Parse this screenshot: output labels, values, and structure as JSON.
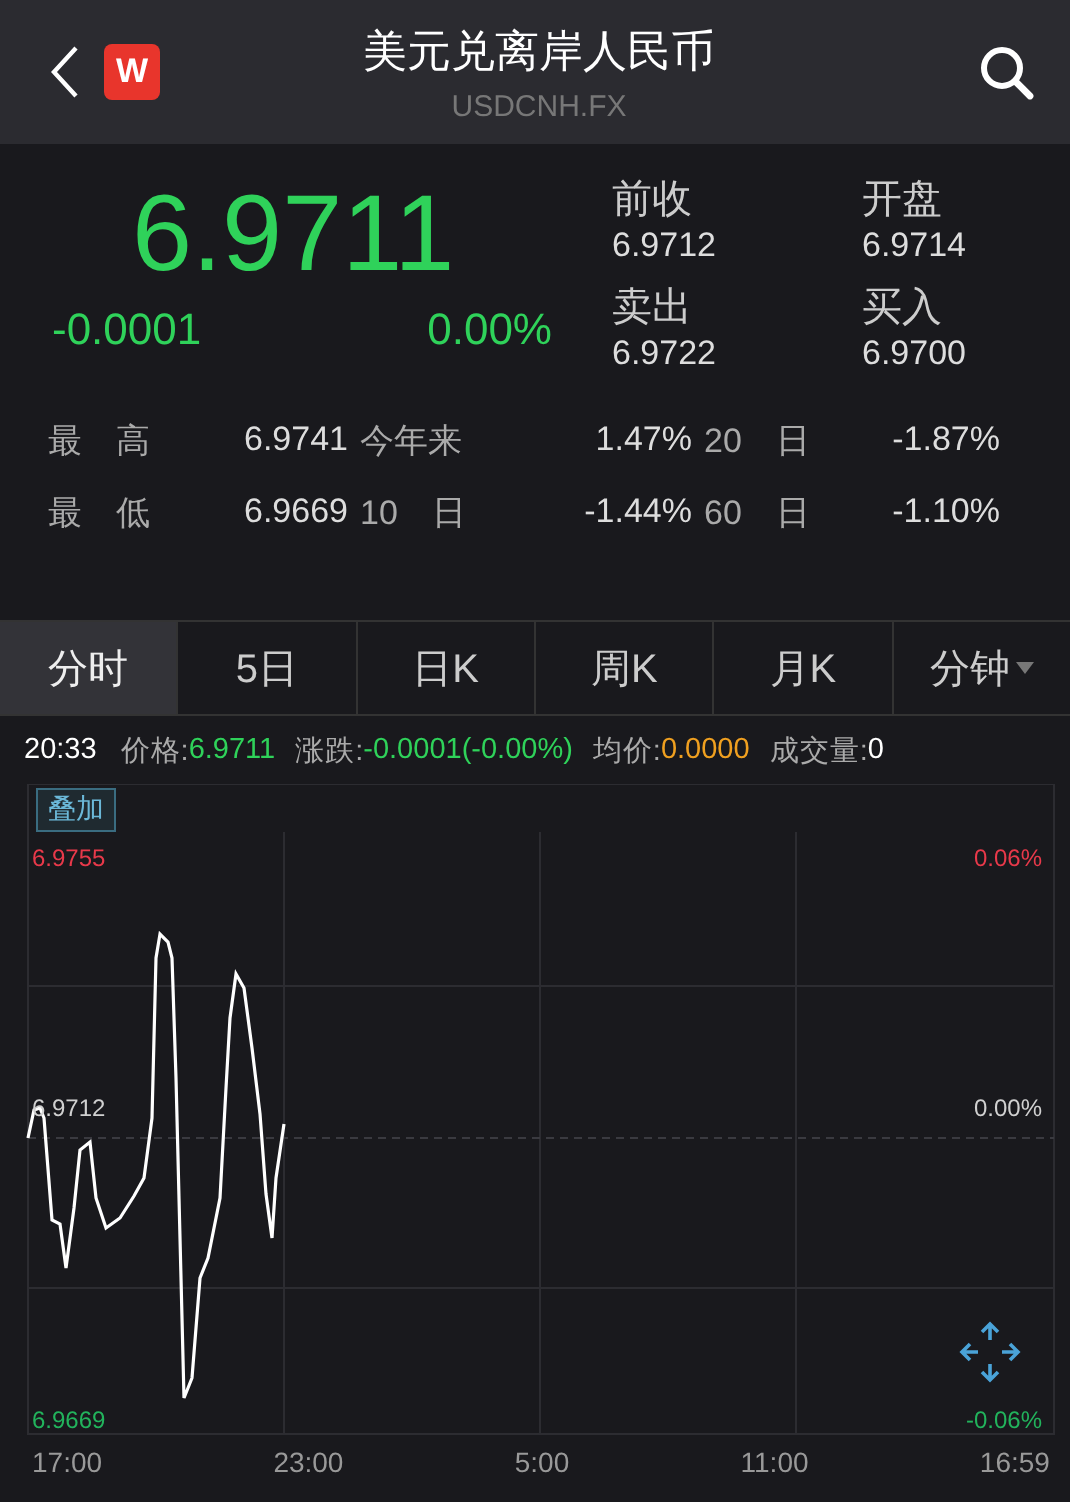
{
  "header": {
    "logo": "W",
    "title": "美元兑离岸人民币",
    "subtitle": "USDCNH.FX"
  },
  "quote": {
    "price": "6.9711",
    "change": "-0.0001",
    "change_pct": "0.00%"
  },
  "stats": [
    {
      "label": "前收",
      "value": "6.9712"
    },
    {
      "label": "开盘",
      "value": "6.9714"
    },
    {
      "label": "卖出",
      "value": "6.9722"
    },
    {
      "label": "买入",
      "value": "6.9700"
    }
  ],
  "ranges": [
    [
      {
        "label": "最　高",
        "value": "6.9741"
      },
      {
        "label": "今年来",
        "value": "1.47%"
      },
      {
        "label": "20　日",
        "value": "-1.87%"
      }
    ],
    [
      {
        "label": "最　低",
        "value": "6.9669"
      },
      {
        "label": "10　日",
        "value": "-1.44%"
      },
      {
        "label": "60　日",
        "value": "-1.10%"
      }
    ]
  ],
  "tabs": [
    {
      "label": "分时",
      "selected": true
    },
    {
      "label": "5日",
      "selected": false
    },
    {
      "label": "日K",
      "selected": false
    },
    {
      "label": "周K",
      "selected": false
    },
    {
      "label": "月K",
      "selected": false
    },
    {
      "label": "分钟",
      "selected": false,
      "dropdown": true
    }
  ],
  "info_bar": {
    "time": "20:33",
    "price_label": "价格:",
    "price": "6.9711",
    "change_label": "涨跌:",
    "change": "-0.0001(-0.00%)",
    "avg_label": "均价:",
    "avg": "0.0000",
    "volume_label": "成交量:",
    "volume": "0"
  },
  "chart": {
    "overlay_button": "叠加",
    "left_labels": [
      {
        "text": "6.9755",
        "kind": "up"
      },
      {
        "text": "6.9712",
        "kind": "flat"
      },
      {
        "text": "6.9669",
        "kind": "down"
      }
    ],
    "right_labels": [
      {
        "text": "0.06%",
        "kind": "up"
      },
      {
        "text": "0.00%",
        "kind": "flat"
      },
      {
        "text": "-0.06%",
        "kind": "down"
      }
    ],
    "x_labels": [
      "17:00",
      "23:00",
      "5:00",
      "11:00",
      "16:59"
    ]
  }
}
